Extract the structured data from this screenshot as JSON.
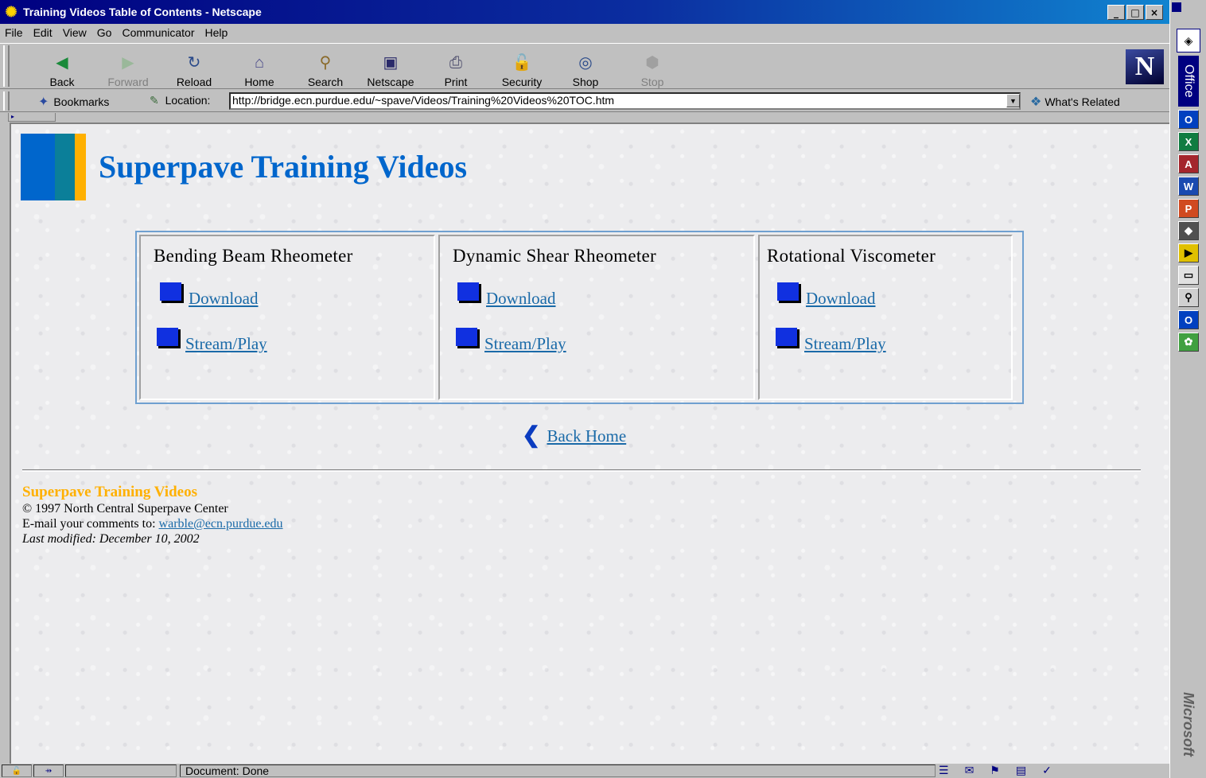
{
  "window": {
    "title": "Training Videos Table of Contents - Netscape",
    "controls": [
      "_",
      "□",
      "×"
    ]
  },
  "menu": [
    "File",
    "Edit",
    "View",
    "Go",
    "Communicator",
    "Help"
  ],
  "toolbar": {
    "buttons": [
      {
        "label": "Back",
        "icon": "back-arrow-icon",
        "enabled": true
      },
      {
        "label": "Forward",
        "icon": "forward-arrow-icon",
        "enabled": false
      },
      {
        "label": "Reload",
        "icon": "reload-icon",
        "enabled": true
      },
      {
        "label": "Home",
        "icon": "home-icon",
        "enabled": true
      },
      {
        "label": "Search",
        "icon": "search-icon",
        "enabled": true
      },
      {
        "label": "Netscape",
        "icon": "my-netscape-icon",
        "enabled": true
      },
      {
        "label": "Print",
        "icon": "print-icon",
        "enabled": true
      },
      {
        "label": "Security",
        "icon": "lock-icon",
        "enabled": true
      },
      {
        "label": "Shop",
        "icon": "shop-icon",
        "enabled": true
      },
      {
        "label": "Stop",
        "icon": "stop-icon",
        "enabled": false
      }
    ],
    "brand": "N"
  },
  "location": {
    "bookmarks_label": "Bookmarks",
    "location_label": "Location:",
    "url": "http://bridge.ecn.purdue.edu/~spave/Videos/Training%20Videos%20TOC.htm",
    "whats_related": "What's Related"
  },
  "page": {
    "title": "Superpave Training Videos",
    "sections": [
      {
        "heading": "Bending Beam Rheometer",
        "download": "Download",
        "stream": "Stream/Play"
      },
      {
        "heading": "Dynamic Shear Rheometer",
        "download": "Download",
        "stream": "Stream/Play"
      },
      {
        "heading": "Rotational Viscometer",
        "download": "Download",
        "stream": "Stream/Play"
      }
    ],
    "back_home": "Back Home",
    "footer": {
      "title": "Superpave Training Videos",
      "copyright": "© 1997 North Central Superpave Center",
      "email_prefix": "E-mail your comments to: ",
      "email": "warble@ecn.purdue.edu",
      "modified": "Last modified: December 10, 2002"
    }
  },
  "status": {
    "text": "Document: Done"
  },
  "office_bar": {
    "label": "Office",
    "vendor": "Microsoft"
  },
  "colors": {
    "title_blue": "#0066cc",
    "accent_orange": "#ffb000",
    "teal": "#0b7f99",
    "link": "#1a6aa8"
  }
}
